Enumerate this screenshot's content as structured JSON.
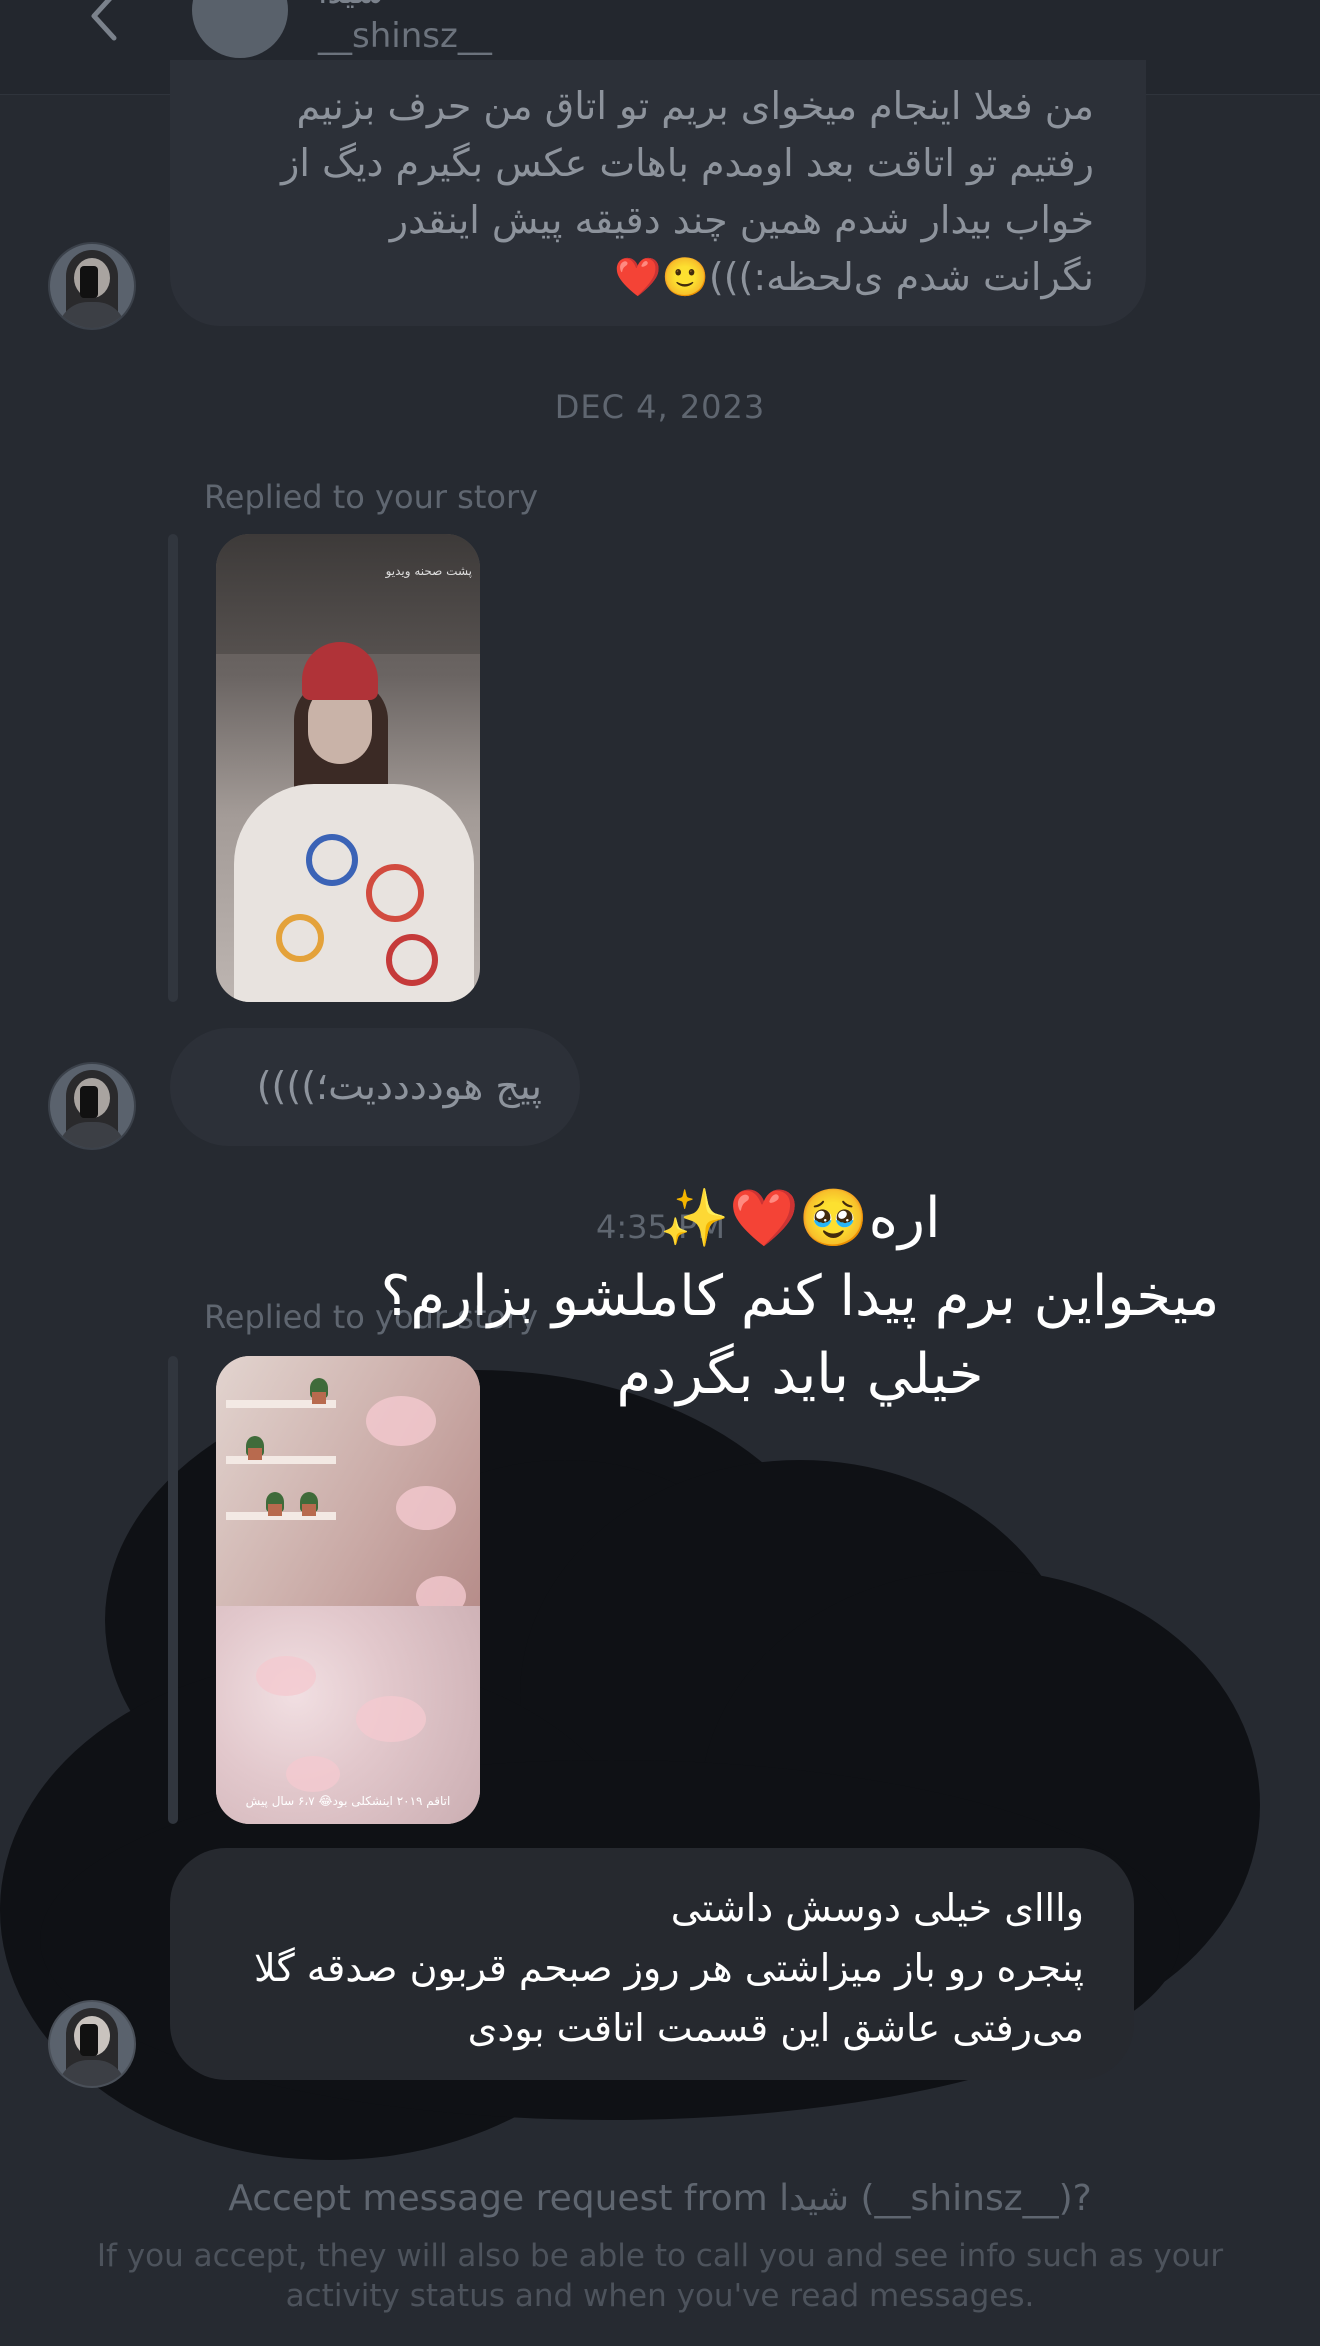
{
  "header": {
    "display_name": "شیدا",
    "username": "__shinsz__"
  },
  "messages": {
    "first": "من فعلا اینجام میخوای بریم تو اتاق من حرف بزنیم\nرفتیم تو اتاقت بعد اومدم باهات عکس بگیرم دیگ از\nخواب بیدار شدم همین چند دقیقه پیش اینقدر\nنگرانت شدم ی‌لحظه:)))🙂❤️",
    "date_separator": "DEC 4, 2023",
    "reply_label_1": "Replied to your story",
    "story1_caption": "پشت صحنه ویدیو",
    "second": "پیج هوددددیت؛))))",
    "time": "4:35 PM",
    "reply_label_2": "Replied to your story",
    "story2_caption": "اتاقم ۲۰۱۹ اینشکلی بود😂 ۶،۷ سال پیش",
    "third": "وااای خیلی دوسش داشتی\nپنجره رو باز میزاشتی هر روز صبحم قربون صدقه گلا\nمی‌رفتی عاشق این قسمت اتاقت بودی"
  },
  "overlay": {
    "line1": "اره🥹❤️✨",
    "line2": "میخواین برم پیدا کنم کاملشو بزارم؟",
    "line3": "خيلي باید بگردم"
  },
  "footer": {
    "title": "Accept message request from شیدا (__shinsz__)?",
    "subtitle": "If you accept, they will also be able to call you and see info such as your activity status and when you've read messages."
  },
  "colors": {
    "background": "#1a1d22",
    "bubble": "#2c3038",
    "overlay": "#0f1115"
  }
}
